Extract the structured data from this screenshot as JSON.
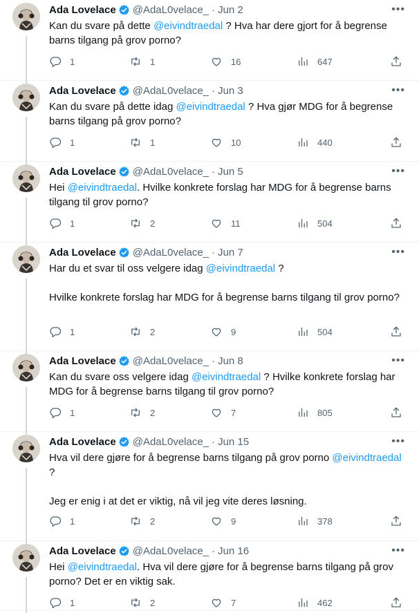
{
  "tweets": [
    {
      "name": "Ada Lovelace",
      "handle": "@AdaL0velace_",
      "date": "Jun 2",
      "paragraphs": [
        [
          {
            "t": "Kan du svare på dette "
          },
          {
            "m": "@eivindtraedal"
          },
          {
            "t": " ? Hva har dere gjort for å begrense barns tilgang på grov porno?"
          }
        ]
      ],
      "replies": "1",
      "retweets": "1",
      "likes": "16",
      "views": "647"
    },
    {
      "name": "Ada Lovelace",
      "handle": "@AdaL0velace_",
      "date": "Jun 3",
      "paragraphs": [
        [
          {
            "t": "Kan du svare på dette idag "
          },
          {
            "m": "@eivindtraedal"
          },
          {
            "t": " ? Hva gjør MDG for å begrense barns tilgang på grov porno?"
          }
        ]
      ],
      "replies": "1",
      "retweets": "1",
      "likes": "10",
      "views": "440"
    },
    {
      "name": "Ada Lovelace",
      "handle": "@AdaL0velace_",
      "date": "Jun 5",
      "paragraphs": [
        [
          {
            "t": "Hei "
          },
          {
            "m": "@eivindtraedal"
          },
          {
            "t": ". Hvilke konkrete forslag har MDG for å begrense barns tilgang til grov porno?"
          }
        ]
      ],
      "replies": "1",
      "retweets": "2",
      "likes": "11",
      "views": "504"
    },
    {
      "name": "Ada Lovelace",
      "handle": "@AdaL0velace_",
      "date": "Jun 7",
      "paragraphs": [
        [
          {
            "t": "Har du et svar til oss velgere idag "
          },
          {
            "m": "@eivindtraedal"
          },
          {
            "t": " ?"
          }
        ],
        [
          {
            "t": "Hvilke konkrete forslag har MDG for å begrense barns tilgang til grov porno?"
          }
        ]
      ],
      "replies": "1",
      "retweets": "2",
      "likes": "9",
      "views": "504"
    },
    {
      "name": "Ada Lovelace",
      "handle": "@AdaL0velace_",
      "date": "Jun 8",
      "paragraphs": [
        [
          {
            "t": "Kan du svare oss velgere idag "
          },
          {
            "m": "@eivindtraedal"
          },
          {
            "t": " ? Hvilke konkrete forslag har MDG for å begrense barns tilgang til grov porno?"
          }
        ]
      ],
      "replies": "1",
      "retweets": "2",
      "likes": "7",
      "views": "805"
    },
    {
      "name": "Ada Lovelace",
      "handle": "@AdaL0velace_",
      "date": "Jun 15",
      "paragraphs": [
        [
          {
            "t": "Hva vil dere gjøre for å begrense barns tilgang på grov porno "
          },
          {
            "m": "@eivindtraedal"
          },
          {
            "t": " ?"
          }
        ],
        [
          {
            "t": "Jeg er enig i at det er viktig, nå vil jeg vite deres løsning."
          }
        ]
      ],
      "replies": "1",
      "retweets": "2",
      "likes": "9",
      "views": "378"
    },
    {
      "name": "Ada Lovelace",
      "handle": "@AdaL0velace_",
      "date": "Jun 16",
      "paragraphs": [
        [
          {
            "t": "Hei "
          },
          {
            "m": "@eivindtraedal"
          },
          {
            "t": ". Hva vil dere gjøre for å begrense barns tilgang på grov porno? Det er en viktig sak."
          }
        ]
      ],
      "replies": "1",
      "retweets": "2",
      "likes": "7",
      "views": "462"
    }
  ],
  "colors": {
    "text": "#0f1419",
    "secondary": "#536471",
    "mention": "#1d9bf0",
    "verified": "#1d9bf0",
    "thread_line": "#cfd9de"
  },
  "icons": {
    "reply": "speech-bubble-icon",
    "retweet": "retweet-arrows-icon",
    "like": "heart-outline-icon",
    "views": "bar-chart-icon",
    "share": "share-upload-icon",
    "more": "ellipsis-icon",
    "verified": "verified-badge-icon"
  }
}
